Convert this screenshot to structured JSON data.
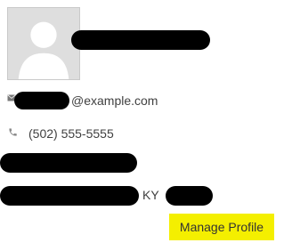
{
  "profile": {
    "avatar_icon": "default-user-avatar",
    "email": {
      "icon": "envelope-icon",
      "domain": "@example.com"
    },
    "phone": {
      "icon": "phone-icon",
      "value": "(502) 555-5555"
    },
    "address": {
      "state": "KY"
    },
    "manage_profile_label": "Manage Profile"
  },
  "colors": {
    "button_background": "#f4ef00",
    "redaction": "#000000",
    "avatar_background": "#dedede"
  }
}
